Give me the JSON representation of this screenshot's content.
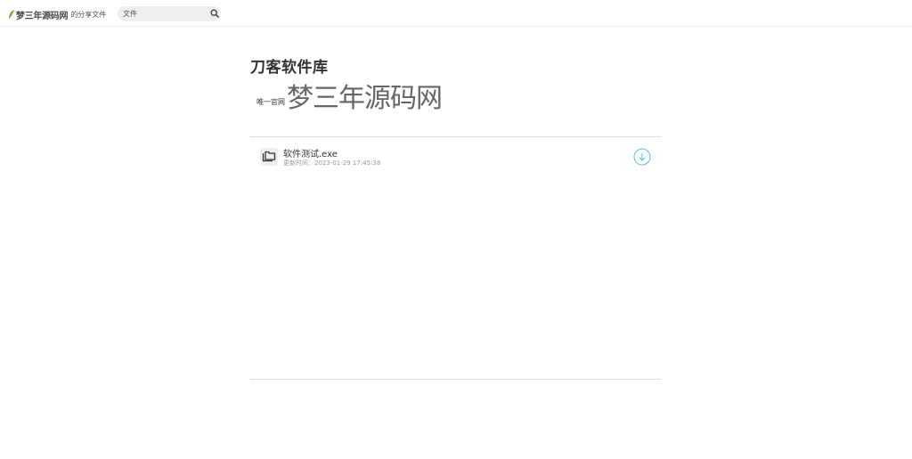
{
  "header": {
    "brand_name": "梦三年源码网",
    "brand_suffix": "的分享文件",
    "search_value": "文件",
    "search_placeholder": "文件"
  },
  "library": {
    "title": "刀客软件库",
    "description_small": "唯一官网",
    "description_big": "梦三年源码网"
  },
  "files": [
    {
      "name": "软件测试.exe",
      "updated": "更新时间：2023-01-29 17:45:38",
      "icon": "folder-copy-icon",
      "action_icon": "download-arrow-icon"
    }
  ],
  "colors": {
    "accent": "#5bc0de",
    "divider": "#dddddd",
    "search_bg": "#eeeeee"
  }
}
